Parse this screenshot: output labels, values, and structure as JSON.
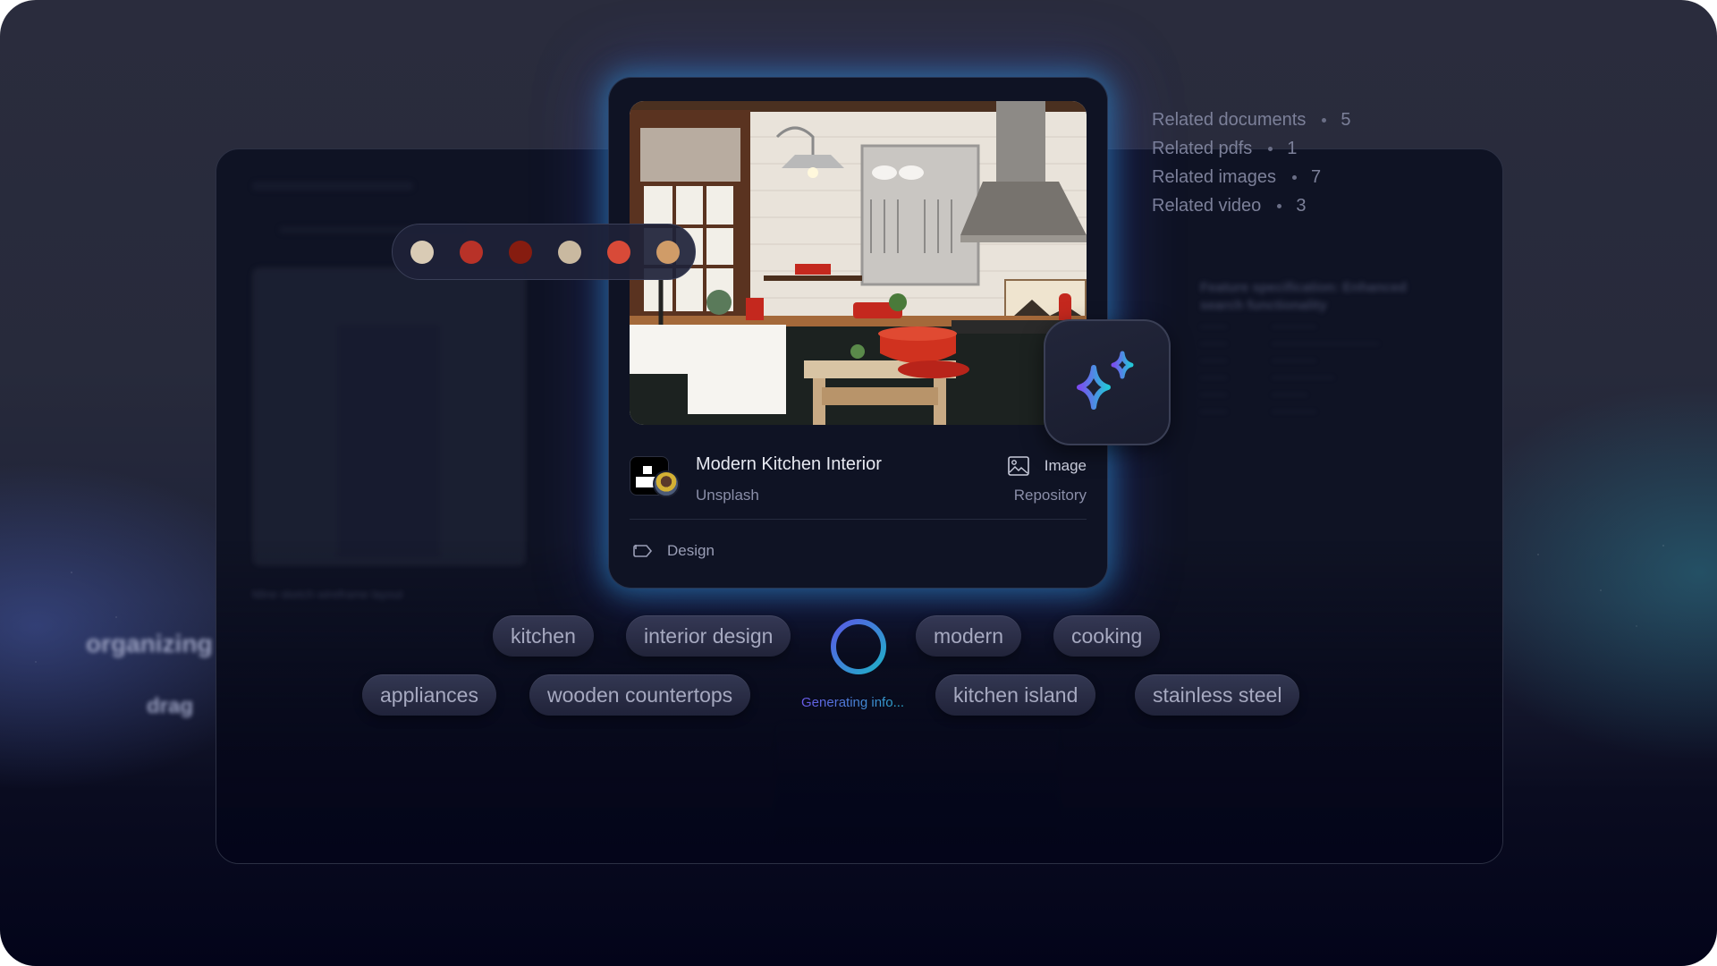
{
  "related": [
    {
      "label": "Related documents",
      "count": "5"
    },
    {
      "label": "Related pdfs",
      "count": "1"
    },
    {
      "label": "Related images",
      "count": "7"
    },
    {
      "label": "Related video",
      "count": "3"
    }
  ],
  "palette": {
    "colors": [
      "#d9cbb5",
      "#b83228",
      "#861c10",
      "#c9b9a0",
      "#d84a38",
      "#d09c68"
    ]
  },
  "card": {
    "image_alt": "Kitchen photo",
    "title": "Modern Kitchen Interior",
    "source": "Unsplash",
    "type_label": "Image",
    "type_sub": "Repository",
    "category": "Design",
    "source_logo_icon": "unsplash-logo-icon",
    "type_icon": "image-icon",
    "category_icon": "folder-tag-icon"
  },
  "ai_button": {
    "icon": "sparkles-icon",
    "gradient": [
      "#7b4df0",
      "#23c8d8"
    ]
  },
  "tags_row1": [
    "kitchen",
    "interior design",
    "modern",
    "cooking"
  ],
  "tags_row2": [
    "appliances",
    "wooden countertops",
    "kitchen island",
    "stainless steel"
  ],
  "status": {
    "generating_text": "Generating info..."
  },
  "background": {
    "blurred_words": [
      "organizing",
      "drag"
    ],
    "panel_heading": "Feature specification: Enhanced search functionality",
    "caption": "Mine sketch wireframe layout"
  }
}
